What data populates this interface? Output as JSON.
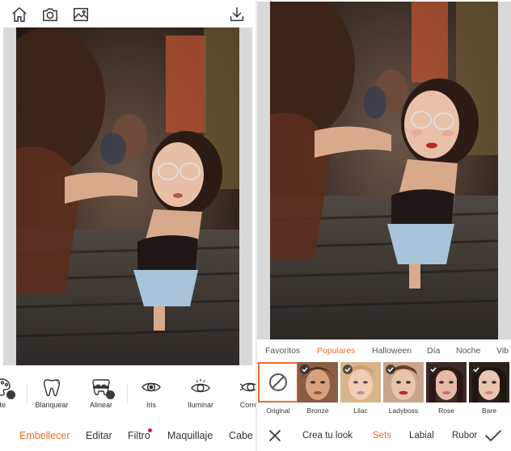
{
  "colors": {
    "accent": "#f06a2a",
    "notification": "#e8143a",
    "text": "#333333"
  },
  "left": {
    "top_bar": {
      "home_icon": "home-icon",
      "camera_icon": "camera-icon",
      "gallery_icon": "image-gallery-icon",
      "download_icon": "download-icon"
    },
    "tools": [
      {
        "label": "tte",
        "icon": "palette-icon",
        "applied": true
      },
      {
        "label": "Blanquear",
        "icon": "tooth-icon",
        "applied": false
      },
      {
        "label": "Alinear",
        "icon": "braces-icon",
        "applied": true
      },
      {
        "label": "Iris",
        "icon": "eye-icon",
        "applied": false
      },
      {
        "label": "Iluminar",
        "icon": "eye-sparkle-icon",
        "applied": false
      },
      {
        "label": "Corre",
        "icon": "eye-correct-icon",
        "applied": false
      }
    ],
    "nav_tabs": [
      {
        "label": "Embellecer",
        "active": true
      },
      {
        "label": "Editar",
        "active": false
      },
      {
        "label": "Filtro",
        "active": false,
        "notification": true
      },
      {
        "label": "Maquillaje",
        "active": false
      },
      {
        "label": "Cabe",
        "active": false
      }
    ]
  },
  "right": {
    "categories": [
      {
        "label": "Favoritos",
        "active": false
      },
      {
        "label": "Populares",
        "active": true
      },
      {
        "label": "Halloween",
        "active": false
      },
      {
        "label": "Día",
        "active": false
      },
      {
        "label": "Noche",
        "active": false
      },
      {
        "label": "Vib",
        "active": false
      }
    ],
    "looks": [
      {
        "label": "Original",
        "selected": true,
        "applied": false
      },
      {
        "label": "Bronze",
        "selected": false,
        "applied": true
      },
      {
        "label": "Lilac",
        "selected": false,
        "applied": true
      },
      {
        "label": "Ladyboss",
        "selected": false,
        "applied": true
      },
      {
        "label": "Rose",
        "selected": false,
        "applied": true
      },
      {
        "label": "Bare",
        "selected": false,
        "applied": true
      }
    ],
    "bottom": {
      "cancel_icon": "close-icon",
      "confirm_icon": "checkmark-icon",
      "tabs": [
        {
          "label": "Crea tu look",
          "active": false
        },
        {
          "label": "Sets",
          "active": true
        },
        {
          "label": "Labial",
          "active": false
        },
        {
          "label": "Rubor",
          "active": false
        }
      ]
    }
  }
}
